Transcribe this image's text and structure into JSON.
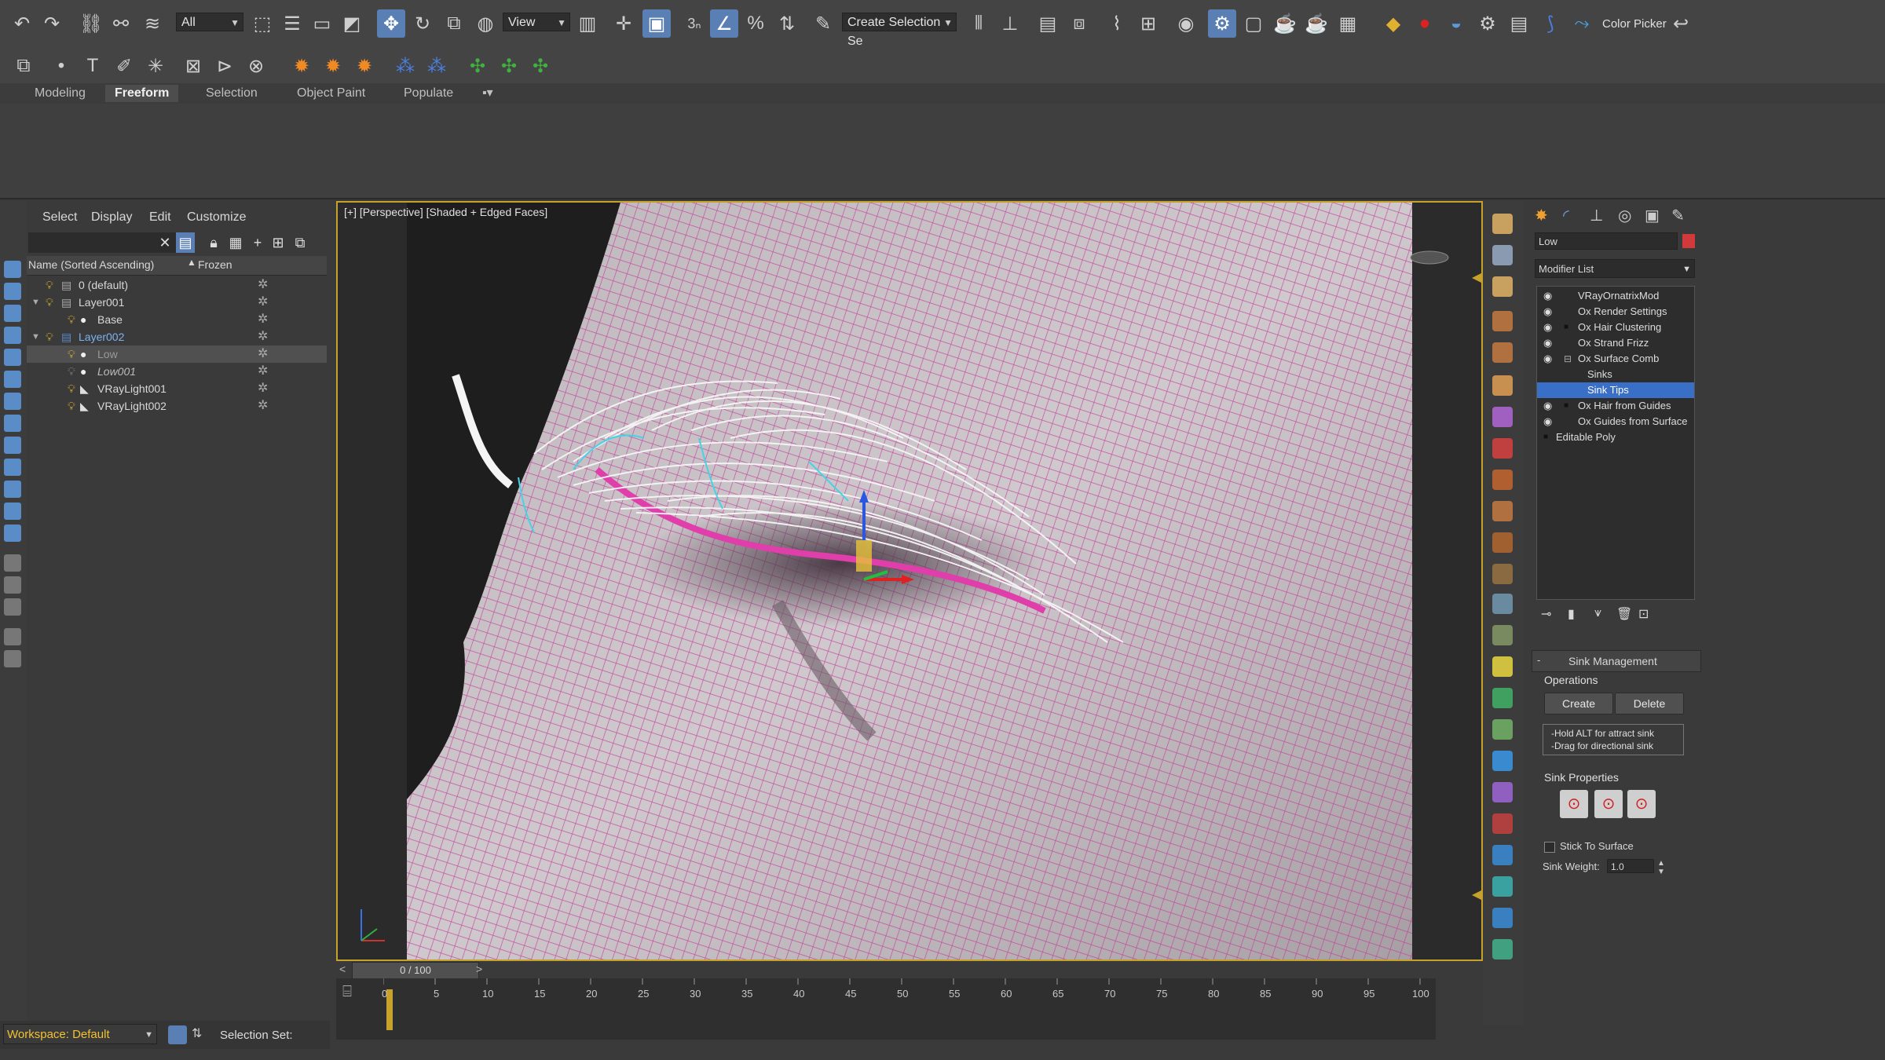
{
  "toolbar": {
    "filter_dropdown": "All",
    "refcoord_dropdown": "View",
    "snap_label": "3",
    "selection_set_placeholder": "Create Selection Se",
    "color_picker_label": "Color Picker"
  },
  "ribbon": {
    "tabs": [
      "Modeling",
      "Freeform",
      "Selection",
      "Object Paint",
      "Populate"
    ],
    "active_tab": "Freeform"
  },
  "explorer": {
    "menu": [
      "Select",
      "Display",
      "Edit",
      "Customize"
    ],
    "header_name": "Name (Sorted Ascending)",
    "header_frozen": "Frozen",
    "rows": [
      {
        "label": "0 (default)"
      },
      {
        "label": "Layer001"
      },
      {
        "label": "Base"
      },
      {
        "label": "Layer002"
      },
      {
        "label": "Low"
      },
      {
        "label": "Low001"
      },
      {
        "label": "VRayLight001"
      },
      {
        "label": "VRayLight002"
      }
    ]
  },
  "workspace": {
    "label": "Workspace: Default",
    "selection_set_label": "Selection Set:"
  },
  "viewport": {
    "label": "[+] [Perspective] [Shaded + Edged Faces]"
  },
  "timeline": {
    "frame_counter": "0 / 100",
    "ticks": [
      "0",
      "5",
      "10",
      "15",
      "20",
      "25",
      "30",
      "35",
      "40",
      "45",
      "50",
      "55",
      "60",
      "65",
      "70",
      "75",
      "80",
      "85",
      "90",
      "95",
      "100"
    ]
  },
  "command_panel": {
    "object_name": "Low",
    "modifier_list_label": "Modifier List",
    "stack": [
      {
        "label": "VRayOrnatrixMod"
      },
      {
        "label": "Ox Render Settings"
      },
      {
        "label": "Ox Hair Clustering"
      },
      {
        "label": "Ox Strand Frizz"
      },
      {
        "label": "Ox Surface Comb"
      },
      {
        "label": "Sinks"
      },
      {
        "label": "Sink Tips"
      },
      {
        "label": "Ox Hair from Guides"
      },
      {
        "label": "Ox Guides from Surface"
      },
      {
        "label": "Editable Poly"
      }
    ],
    "sink_management_title": "Sink Management",
    "operations_label": "Operations",
    "create_button": "Create",
    "delete_button": "Delete",
    "hint_line1": "-Hold ALT for attract sink",
    "hint_line2": "-Drag for directional sink",
    "sink_properties_label": "Sink Properties",
    "stick_to_surface_label": "Stick To Surface",
    "sink_weight_label": "Sink Weight:",
    "sink_weight_value": "1.0"
  },
  "colors": {
    "accent": "#3a6fc7",
    "viewport_border": "#c7a22a",
    "wire": "#c43c9a"
  }
}
